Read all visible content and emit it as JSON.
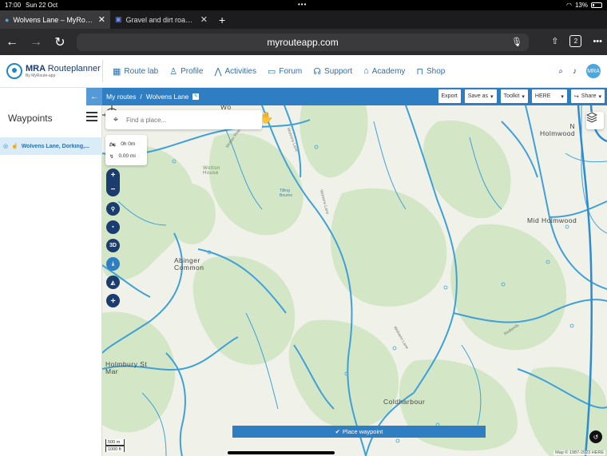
{
  "status_bar": {
    "time": "17:00",
    "date": "Sun 22 Oct",
    "battery": "13%"
  },
  "browser": {
    "tabs": [
      {
        "label": "Wolvens Lane – MyRouteApp",
        "active": true
      },
      {
        "label": "Gravel and dirt roads...how",
        "active": false
      }
    ],
    "url": "myrouteapp.com",
    "tab_count": "2"
  },
  "app": {
    "logo": {
      "brand": "MRA",
      "name": "Routeplanner",
      "tagline": "By MyRoute-app"
    },
    "nav": [
      {
        "label": "Route lab",
        "icon": "map-icon"
      },
      {
        "label": "Profile",
        "icon": "user-icon"
      },
      {
        "label": "Activities",
        "icon": "activity-icon"
      },
      {
        "label": "Forum",
        "icon": "chat-icon"
      },
      {
        "label": "Support",
        "icon": "headset-icon"
      },
      {
        "label": "Academy",
        "icon": "graduation-icon"
      },
      {
        "label": "Shop",
        "icon": "bag-icon"
      }
    ],
    "avatar": "MRA"
  },
  "route_bar": {
    "breadcrumb_root": "My routes",
    "separator": "/",
    "route_name": "Wolvens Lane",
    "buttons": {
      "export": "Export",
      "save_as": "Save as",
      "toolkit": "Toolkit",
      "provider": "HERE",
      "share": "Share"
    }
  },
  "sidebar": {
    "title": "Waypoints",
    "waypoints": [
      {
        "label": "Wolvens Lane, Dorking,..."
      }
    ]
  },
  "map": {
    "search_placeholder": "Find a place...",
    "stats": {
      "duration": "0h 0m",
      "distance": "0.00 mi"
    },
    "controls": {
      "zoom_in": "+",
      "zoom_out": "−",
      "three_d": "3D"
    },
    "labels": {
      "wotton_house": "Wotton\nHouse",
      "abinger_common": "Abinger\nCommon",
      "holmbury_st_mary": "Holmbury St\nMar",
      "coldharbour": "Coldharbour",
      "mid_holmwood": "Mid Holmwood",
      "north_holmwood": "N\nHolmwood",
      "wolvens_lane_1": "Wolvens Lane",
      "wolvens_lane_2": "Wolvens Lane",
      "wolvens_lane_3": "Wolvens Lane",
      "tilling_bourne": "Tilling Bourne",
      "wotton_road": "Wotton Road",
      "redlands": "Redlands",
      "wo_top": "Wo"
    },
    "place_waypoint": "Place waypoint",
    "scale": {
      "metric": "500 m",
      "imperial": "1000 ft"
    },
    "copyright": "Map © 1987-2023 HERE"
  },
  "colors": {
    "accent": "#2f7dc3",
    "dark": "#1a3c6e",
    "road": "#3fa0d8",
    "forest": "#d3e7c6",
    "background": "#f0f2ea"
  }
}
